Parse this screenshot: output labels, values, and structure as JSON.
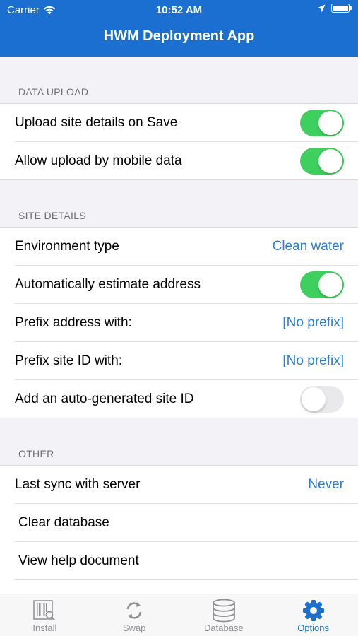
{
  "status_bar": {
    "carrier": "Carrier",
    "time": "10:52 AM"
  },
  "app": {
    "title": "HWM Deployment App"
  },
  "sections": {
    "data_upload": {
      "header": "DATA UPLOAD",
      "upload_on_save": {
        "label": "Upload site details on Save",
        "on": true
      },
      "mobile_data": {
        "label": "Allow upload by mobile data",
        "on": true
      }
    },
    "site_details": {
      "header": "SITE DETAILS",
      "environment": {
        "label": "Environment type",
        "value": "Clean water"
      },
      "estimate_address": {
        "label": "Automatically estimate address",
        "on": true
      },
      "prefix_address": {
        "label": "Prefix address with:",
        "value": "[No prefix]"
      },
      "prefix_site_id": {
        "label": "Prefix site ID with:",
        "value": "[No prefix]"
      },
      "auto_site_id": {
        "label": "Add an auto-generated site ID",
        "on": false
      }
    },
    "other": {
      "header": "OTHER",
      "last_sync": {
        "label": "Last sync with server",
        "value": "Never"
      },
      "clear_db": {
        "label": "Clear database"
      },
      "help_doc": {
        "label": "View help document"
      }
    }
  },
  "tabs": [
    {
      "label": "Install",
      "icon": "barcode-scan-icon",
      "active": false
    },
    {
      "label": "Swap",
      "icon": "swap-arrows-icon",
      "active": false
    },
    {
      "label": "Database",
      "icon": "database-icon",
      "active": false
    },
    {
      "label": "Options",
      "icon": "gear-icon",
      "active": true
    }
  ],
  "colors": {
    "brand": "#1a6fd0",
    "toggle_on": "#3fcf5e",
    "value_link": "#2a7dd1"
  }
}
